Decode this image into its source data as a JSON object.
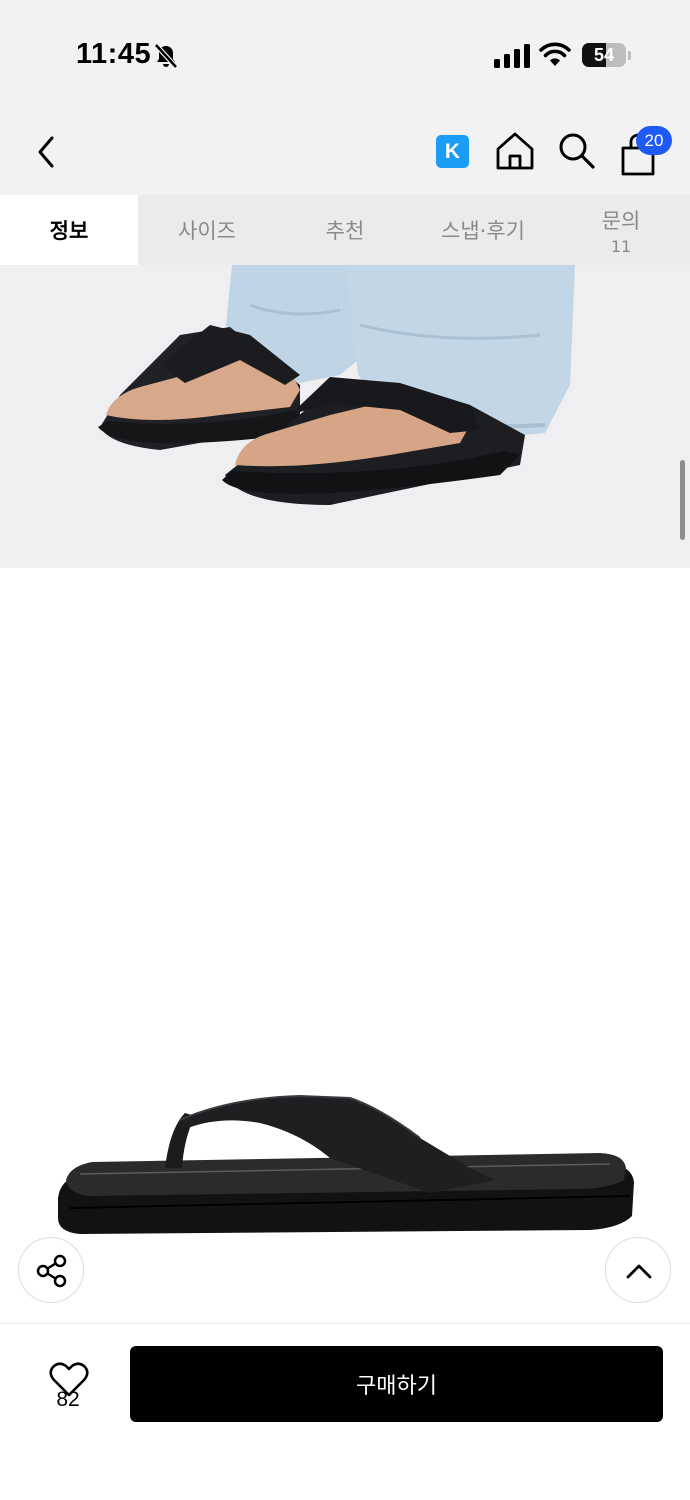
{
  "status_bar": {
    "time": "11:45",
    "battery_level": "54",
    "battery_fraction": 0.54
  },
  "header": {
    "k_badge": "K",
    "cart_count": "20"
  },
  "tabs": [
    {
      "label": "정보",
      "active": true
    },
    {
      "label": "사이즈",
      "active": false
    },
    {
      "label": "추천",
      "active": false
    },
    {
      "label": "스냅·후기",
      "active": false
    },
    {
      "label": "문의",
      "count": "11",
      "active": false
    }
  ],
  "bottom_bar": {
    "like_count": "82",
    "buy_label": "구매하기"
  },
  "icons": {
    "back": "chevron-left-icon",
    "home": "home-icon",
    "search": "search-icon",
    "cart": "shopping-bag-icon",
    "share": "share-icon",
    "scroll_top": "chevron-up-icon",
    "like": "heart-icon",
    "mute": "bell-slash-icon",
    "signal": "cellular-signal-icon",
    "wifi": "wifi-icon",
    "battery": "battery-icon"
  },
  "colors": {
    "k_badge": "#1b9cf5",
    "cart_badge": "#1e5bf6",
    "buy_button": "#000000"
  }
}
